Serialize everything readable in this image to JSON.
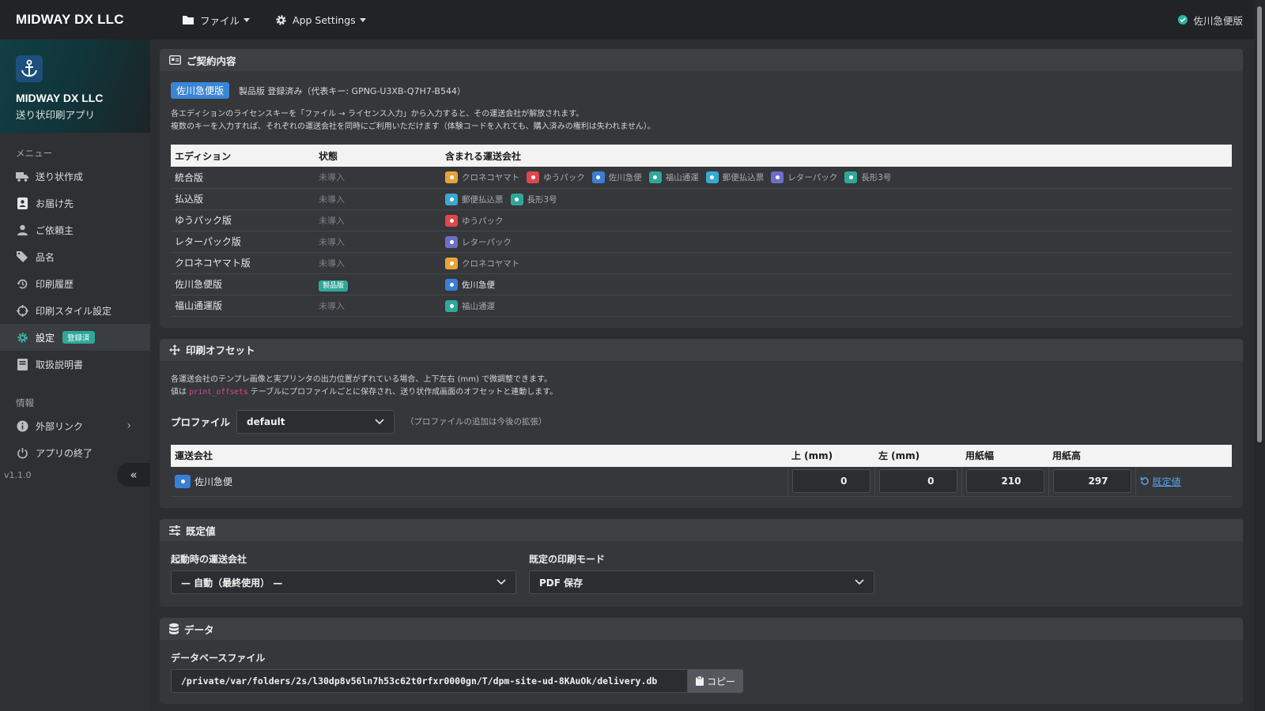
{
  "topbar": {
    "brand": "MIDWAY DX LLC",
    "file_menu": "ファイル",
    "settings_menu": "App Settings",
    "edition": "佐川急便版"
  },
  "sidebar": {
    "app_name": "MIDWAY DX LLC",
    "app_sub": "送り状印刷アプリ",
    "section_menu": "メニュー",
    "items": [
      {
        "label": "送り状作成",
        "icon": "truck-icon"
      },
      {
        "label": "お届け先",
        "icon": "address-book-icon"
      },
      {
        "label": "ご依頼主",
        "icon": "user-icon"
      },
      {
        "label": "品名",
        "icon": "tags-icon"
      },
      {
        "label": "印刷履歴",
        "icon": "history-icon"
      },
      {
        "label": "印刷スタイル設定",
        "icon": "crosshair-icon"
      },
      {
        "label": "設定",
        "icon": "gear-icon",
        "badge": "登録済"
      },
      {
        "label": "取扱説明書",
        "icon": "book-icon"
      }
    ],
    "section_info": "情報",
    "info_items": [
      {
        "label": "外部リンク",
        "icon": "info-icon"
      },
      {
        "label": "アプリの終了",
        "icon": "power-icon"
      }
    ],
    "version": "v1.1.0",
    "collapse": "«"
  },
  "contract": {
    "title": "ご契約内容",
    "badge": "佐川急便版",
    "status": "製品版 登録済み（代表キー: GPNG-U3XB-Q7H7-B544）",
    "desc1": "各エディションのライセンスキーを「ファイル → ライセンス入力」から入力すると、その運送会社が解放されます。",
    "desc2": "複数のキーを入力すれば、それぞれの運送会社を同時にご利用いただけます（体験コードを入れても、購入済みの権利は失われません）。",
    "headers": [
      "エディション",
      "状態",
      "含まれる運送会社"
    ],
    "rows": [
      {
        "edition": "統合版",
        "status": "未導入",
        "carriers": [
          "クロネコヤマト",
          "ゆうパック",
          "佐川急便",
          "福山通運",
          "郵便払込票",
          "レターパック",
          "長形3号"
        ]
      },
      {
        "edition": "払込版",
        "status": "未導入",
        "carriers": [
          "郵便払込票",
          "長形3号"
        ]
      },
      {
        "edition": "ゆうパック版",
        "status": "未導入",
        "carriers": [
          "ゆうパック"
        ]
      },
      {
        "edition": "レターパック版",
        "status": "未導入",
        "carriers": [
          "レターパック"
        ]
      },
      {
        "edition": "クロネコヤマト版",
        "status": "未導入",
        "carriers": [
          "クロネコヤマト"
        ]
      },
      {
        "edition": "佐川急便版",
        "status": "製品版",
        "carriers": [
          "佐川急便"
        ]
      },
      {
        "edition": "福山通運版",
        "status": "未導入",
        "carriers": [
          "福山通運"
        ]
      }
    ]
  },
  "carrier_colors": {
    "クロネコヤマト": "#e8a33a",
    "ゆうパック": "#e0464a",
    "佐川急便": "#3a7fd6",
    "福山通運": "#2fa89a",
    "郵便払込票": "#3aa9cf",
    "レターパック": "#6b6fc8",
    "長形3号": "#2fa89a"
  },
  "offset": {
    "title": "印刷オフセット",
    "desc1": "各運送会社のテンプレ画像と実プリンタの出力位置がずれている場合、上下左右 (mm) で微調整できます。",
    "desc2_pre": "値は",
    "desc2_code": "print_offsets",
    "desc2_post": "テーブルにプロファイルごとに保存され、送り状作成画面のオフセットと連動します。",
    "profile_label": "プロファイル",
    "profile_value": "default",
    "profile_hint": "（プロファイルの追加は今後の拡張）",
    "headers": [
      "運送会社",
      "上 (mm)",
      "左 (mm)",
      "用紙幅",
      "用紙高"
    ],
    "row": {
      "carrier": "佐川急便",
      "top": "0",
      "left": "0",
      "width": "210",
      "height": "297",
      "reset": "既定値"
    }
  },
  "defaults": {
    "title": "既定値",
    "carrier_label": "起動時の運送会社",
    "carrier_value": "— 自動（最終使用） —",
    "mode_label": "既定の印刷モード",
    "mode_value": "PDF 保存"
  },
  "data": {
    "title": "データ",
    "db_label": "データベースファイル",
    "db_path": "/private/var/folders/2s/l30dp8v56ln7h53c62t0rfxr0000gn/T/dpm-site-ud-8KAuOk/delivery.db",
    "copy": "コピー"
  }
}
